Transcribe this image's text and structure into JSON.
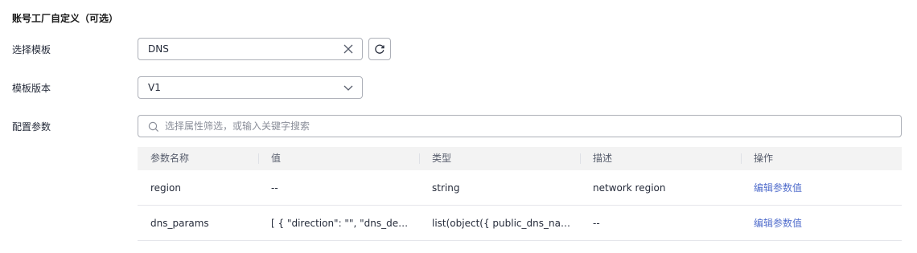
{
  "section": {
    "title": "账号工厂自定义（可选）"
  },
  "template": {
    "label": "选择模板",
    "value": "DNS",
    "clear_icon": "close-icon",
    "refresh_icon": "refresh-icon"
  },
  "version": {
    "label": "模板版本",
    "value": "V1",
    "dropdown_icon": "chevron-down-icon"
  },
  "params": {
    "label": "配置参数",
    "search_placeholder": "选择属性筛选，或输入关键字搜索",
    "search_icon": "search-icon"
  },
  "table": {
    "headers": [
      "参数名称",
      "值",
      "类型",
      "描述",
      "操作"
    ],
    "rows": [
      {
        "name": "region",
        "value": "--",
        "type": "string",
        "description": "network region",
        "action": "编辑参数值"
      },
      {
        "name": "dns_params",
        "value": "[ { \"direction\": \"\", \"dns_descri...",
        "type": "list(object({ public_dns_nam...",
        "description": "--",
        "action": "编辑参数值"
      }
    ]
  },
  "colors": {
    "link": "#526ecc",
    "border": "#adb0b8",
    "header_bg": "#f3f3f3"
  }
}
